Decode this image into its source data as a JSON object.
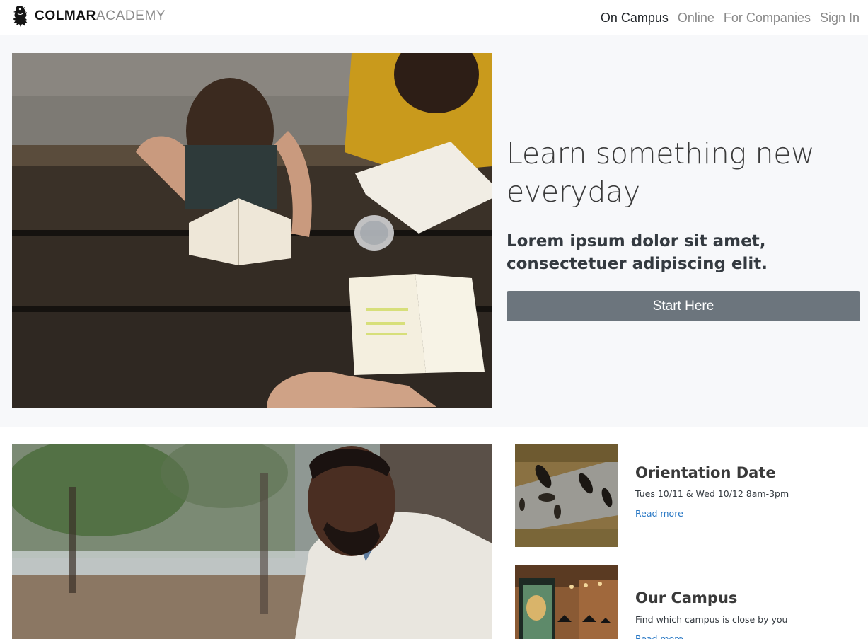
{
  "brand": {
    "name_bold": "COLMAR",
    "name_light": "ACADEMY",
    "logo_icon": "lion-rampant-icon"
  },
  "nav": {
    "items": [
      {
        "label": "On Campus",
        "active": true
      },
      {
        "label": "Online",
        "active": false
      },
      {
        "label": "For Companies",
        "active": false
      },
      {
        "label": "Sign In",
        "active": false
      }
    ]
  },
  "hero": {
    "heading": "Learn something new everyday",
    "lead": "Lorem ipsum dolor sit amet, consectetuer adipiscing elit.",
    "cta_label": "Start Here"
  },
  "cards": [
    {
      "title": "Orientation Date",
      "text": "Tues 10/11 & Wed 10/12 8am-3pm",
      "link": "Read more"
    },
    {
      "title": "Our Campus",
      "text": "Find which campus is close by you",
      "link": "Read more"
    }
  ],
  "colors": {
    "button": "#6c757d",
    "link": "#2777c4",
    "hero_bg": "#f7f8fa",
    "nav_active": "#212529",
    "nav_inactive": "#8a8a8a"
  }
}
